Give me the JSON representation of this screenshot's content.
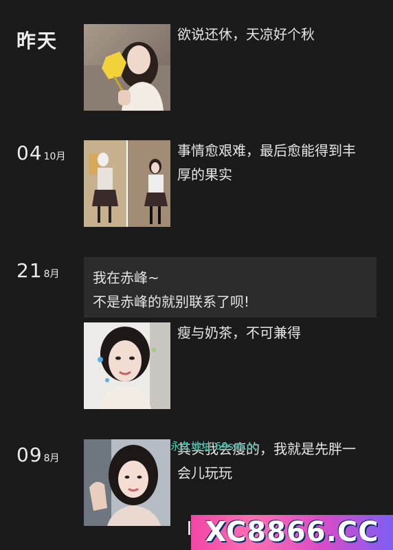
{
  "feed": {
    "yesterday_label": "昨天",
    "posts": [
      {
        "day": "",
        "month": "",
        "caption": "欲说还休，天凉好个秋"
      },
      {
        "day": "04",
        "month": "10月",
        "caption": "事情愈艰难，最后愈能得到丰厚的果实"
      },
      {
        "day": "21",
        "month": "8月",
        "text_lines": [
          "我在赤峰~",
          "不是赤峰的就别联系了呗!"
        ],
        "caption": "瘦与奶茶，不可兼得"
      },
      {
        "day": "09",
        "month": "8月",
        "caption": "其实我会瘦的，我就是先胖一会儿玩玩"
      }
    ]
  },
  "overlay": {
    "watermark": "永久地址 69sm.cc",
    "banner": "XC8866.CC"
  },
  "colors": {
    "background": "#1b1b1b",
    "text_post_bg": "#2c2c2c",
    "watermark": "#36e0c6",
    "banner_start": "#f046a6",
    "banner_end": "#7d5ef6"
  }
}
